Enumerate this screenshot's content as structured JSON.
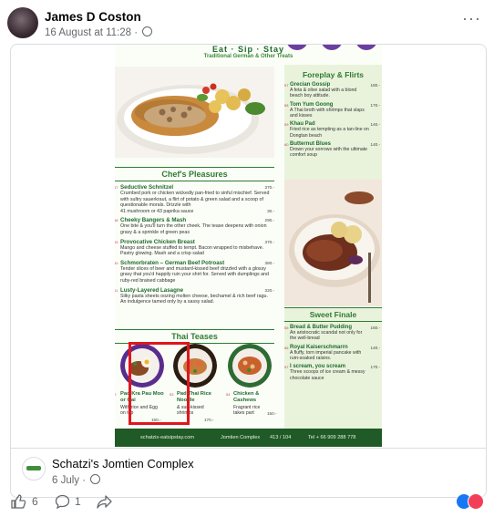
{
  "post": {
    "author": "James D Coston",
    "date": "16 August at 11:28",
    "dot": "·",
    "more": "···"
  },
  "menu": {
    "tagline": "Eat · Sip · Stay",
    "subtitle": "Traditional German & Other Treats",
    "chefs_title": "Chef's Pleasures",
    "chefs_items": [
      {
        "num": "47",
        "name": "Seductive Schnitzel",
        "price": "370.-",
        "desc": "Crumbed pork or chicken wickedly pan-fried to sinful mischief. Served with sultry sauerkraut, a flirt of potato & green salad and a scoop of questionable morals. Drizzle with",
        "extra": "41 mushroom or 43 paprika sauce",
        "extra_price": "30.-"
      },
      {
        "num": "48",
        "name": "Cheeky Bangers & Mash",
        "price": "290.-",
        "desc": "One bite & you'll turn the other cheek. The tease deepens with onion gravy & a sprinkle of green peas"
      },
      {
        "num": "49",
        "name": "Provocative Chicken Breast",
        "price": "370.-",
        "desc": "Mango and cheese stuffed to tempt. Bacon wrapped to misbehave. Pastry glowing. Mash and a crisp salad"
      },
      {
        "num": "50",
        "name": "Schmorbraten – German Beef Potroast",
        "price": "380.-",
        "desc": "Tender slices of beer and mustard-kissed beef drizzled with a glossy gravy that you'd happily ruin your shirt for. Served with dumplings and ruby-red braised cabbage"
      },
      {
        "num": "51",
        "name": "Lusty-Layered Lasagne",
        "price": "320.-",
        "desc": "Silky pasta sheets oozing molten cheese, bechamel & rich beef ragu. An indulgence tamed only by a sassy salad."
      }
    ],
    "thai_title": "Thai Teases",
    "thai_items": [
      {
        "num": "52",
        "name": "Pad Kra Pau Moo or Gai",
        "desc": "With rice and Egg on top",
        "price": "150.-"
      },
      {
        "num": "53",
        "name": "Pad Thai Rice Noodle",
        "desc": "& sun-kissed shrimps",
        "price": "170.-"
      },
      {
        "num": "54",
        "name": "Chicken & Cashews",
        "desc": "Fragrant rice takes part",
        "price": "150.-"
      }
    ],
    "foreplay_title": "Foreplay & Flirts",
    "foreplay_items": [
      {
        "num": "57",
        "name": "Grecian Gossip",
        "price": "180.-",
        "desc": "A feta & olive salad with a blond beach boy attitude."
      },
      {
        "num": "58",
        "name": "Tom Yum Goong",
        "price": "170.-",
        "desc": "A Thai broth with shrimps that slaps and kisses"
      },
      {
        "num": "59",
        "name": "Khau Pad",
        "price": "140.-",
        "desc": "Fried rice as tempting as a tan-line on Dongtan beach"
      },
      {
        "num": "60",
        "name": "Butternut Blues",
        "price": "140.-",
        "desc": "Drown your sorrows with the ultimate comfort soup"
      }
    ],
    "finale_title": "Sweet Finale",
    "finale_items": [
      {
        "num": "55",
        "name": "Bread & Butter Pudding",
        "price": "160.-",
        "desc": "An aristocratic scandal not only for the well-bread"
      },
      {
        "num": "56",
        "name": "Royal Kaiserschmarrn",
        "price": "140.-",
        "desc": "A fluffy, torn imperial pancake with rum-soaked raisins."
      },
      {
        "num": "57",
        "name": "I scream, you scream",
        "price": "170.-",
        "desc": "Three scoops of ice cream & messy chocolate sauce"
      }
    ],
    "footer": {
      "website": "schatzis-eatsipstay.com",
      "location": "Jomtien Complex",
      "address": "413 / 104",
      "phone": "Tel + 66 909 288 778"
    }
  },
  "link": {
    "page_name": "Schatzi's Jomtien Complex",
    "date": "6 July",
    "dot": "·"
  },
  "actions": {
    "likes": "6",
    "comments": "1"
  },
  "colors": {
    "accent_green": "#1f6b2e",
    "panel_green": "#e9f3dc",
    "highlight_red": "#e0161d"
  }
}
